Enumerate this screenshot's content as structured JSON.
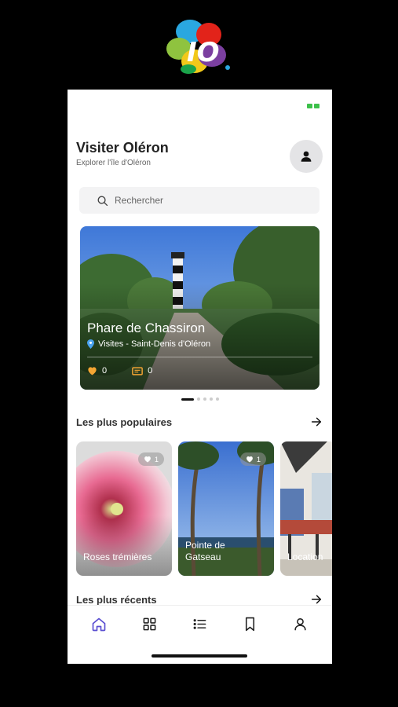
{
  "colors": {
    "accent": "#5a4ed1",
    "status": "#3cc04a",
    "heart": "#f4a533",
    "pin": "#4aa3f0"
  },
  "logo": {
    "text": "IO",
    "icon": "oleron-logo"
  },
  "header": {
    "title": "Visiter Oléron",
    "subtitle": "Explorer l'île d'Oléron",
    "avatar_icon": "user-icon"
  },
  "search": {
    "placeholder": "Rechercher",
    "icon": "search-icon"
  },
  "featured": {
    "title": "Phare de Chassiron",
    "subtitle": "Visites - Saint-Denis d'Oléron",
    "likes": "0",
    "reviews": "0",
    "page_count": 5,
    "active_page": 1
  },
  "popular": {
    "title": "Les plus populaires",
    "items": [
      {
        "label": "Roses trémières",
        "likes": "1"
      },
      {
        "label": "Pointe de Gatseau",
        "likes": "1"
      },
      {
        "label": "Location"
      }
    ]
  },
  "recent": {
    "title": "Les plus récents"
  },
  "nav": {
    "items": [
      {
        "icon": "home-icon",
        "active": true
      },
      {
        "icon": "grid-icon",
        "active": false
      },
      {
        "icon": "list-icon",
        "active": false
      },
      {
        "icon": "bookmark-icon",
        "active": false
      },
      {
        "icon": "profile-icon",
        "active": false
      }
    ]
  }
}
